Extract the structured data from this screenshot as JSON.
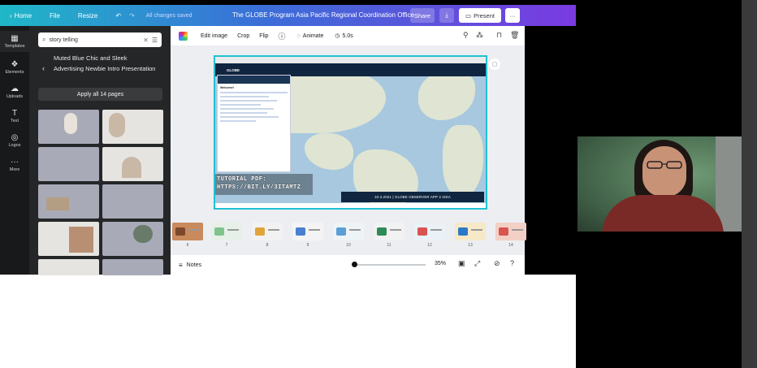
{
  "topbar": {
    "home": "Home",
    "file": "File",
    "resize": "Resize",
    "saved_status": "All changes saved",
    "title": "The GLOBE Program Asia Pacific Regional Coordination Office",
    "share": "Share",
    "present": "Present",
    "more": "···"
  },
  "rail": {
    "templates": "Templates",
    "elements": "Elements",
    "uploads": "Uploads",
    "text": "Text",
    "logos": "Logos",
    "more": "More"
  },
  "panel": {
    "search_value": "story telling",
    "template_title": "Muted Blue Chic and Sleek Advertising Newbie Intro Presentation",
    "apply_button": "Apply all 14 pages"
  },
  "toolbar": {
    "edit_image": "Edit image",
    "crop": "Crop",
    "flip": "Flip",
    "animate": "Animate",
    "duration": "5.0s"
  },
  "slide": {
    "globe_brand": "GLOBE",
    "tutorial_line1": "TUTORIAL PDF:",
    "tutorial_line2": "HTTPS://BIT.LY/3ITAMTZ",
    "footer": "10.3.2021 | GLOBE OBSERVER APP 4 ISSA",
    "popup_title": "Welcome!"
  },
  "pages": {
    "numbers": [
      "6",
      "7",
      "8",
      "9",
      "10",
      "11",
      "12",
      "13",
      "14"
    ]
  },
  "bottom": {
    "notes": "Notes",
    "zoom": "35%"
  },
  "colors": {
    "accent": "#1fc3d3",
    "topbar_start": "#1fb8c8",
    "topbar_end": "#7a3ae0",
    "panel_bg": "#252627",
    "slide_navy": "#10253f"
  }
}
